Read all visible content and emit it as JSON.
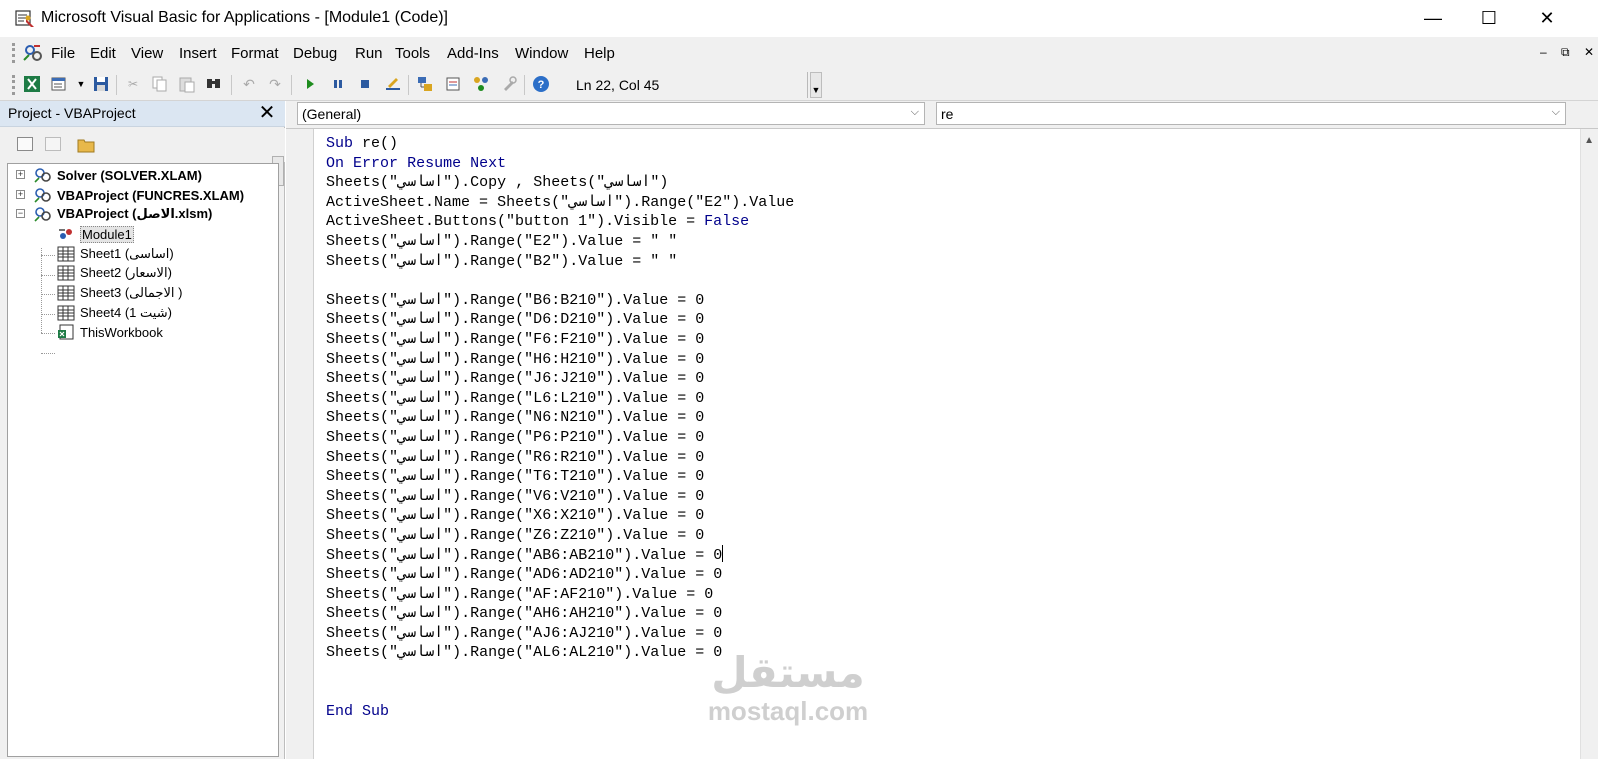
{
  "window": {
    "title": "Microsoft Visual Basic for Applications - [Module1 (Code)]",
    "minimize": "—",
    "maximize": "☐",
    "close": "✕"
  },
  "menu": {
    "items": [
      "File",
      "Edit",
      "View",
      "Insert",
      "Format",
      "Debug",
      "Run",
      "Tools",
      "Add-Ins",
      "Window",
      "Help"
    ],
    "mdi": {
      "minimize": "–",
      "restore": "⧉",
      "close": "✕"
    }
  },
  "toolbar": {
    "status": "Ln 22, Col 45",
    "icons": [
      "excel-icon",
      "insert-module-icon",
      "save-icon",
      "cut-icon",
      "copy-icon",
      "paste-icon",
      "find-icon",
      "undo-icon",
      "redo-icon",
      "run-icon",
      "break-icon",
      "reset-icon",
      "design-mode-icon",
      "project-explorer-icon",
      "properties-icon",
      "object-browser-icon",
      "toolbox-icon",
      "help-icon"
    ]
  },
  "project": {
    "title": "Project - VBAProject",
    "close": "✕",
    "nodes": [
      {
        "label": "Solver (SOLVER.XLAM)",
        "expander": "+"
      },
      {
        "label": "VBAProject (FUNCRES.XLAM)",
        "expander": "+"
      },
      {
        "label": "VBAProject (الاصل.xlsm)",
        "expander": "−"
      },
      {
        "label": "Module1"
      },
      {
        "label": "Sheet1 (اساسى)"
      },
      {
        "label": "Sheet2 (الاسعار)"
      },
      {
        "label": "Sheet3 (الاجمالى )"
      },
      {
        "label": "Sheet4 (شيت 1)"
      },
      {
        "label": "ThisWorkbook"
      }
    ]
  },
  "code": {
    "object_combo": "(General)",
    "proc_combo": "re",
    "lines": [
      "Sub re()",
      "On Error Resume Next",
      "Sheets(\"اساسي\").Copy , Sheets(\"اساسي\")",
      "ActiveSheet.Name = Sheets(\"اساسي\").Range(\"E2\").Value",
      "ActiveSheet.Buttons(\"button 1\").Visible = False",
      "Sheets(\"اساسي\").Range(\"E2\").Value = \" \"",
      "Sheets(\"اساسي\").Range(\"B2\").Value = \" \"",
      "",
      "Sheets(\"اساسي\").Range(\"B6:B210\").Value = 0",
      "Sheets(\"اساسي\").Range(\"D6:D210\").Value = 0",
      "Sheets(\"اساسي\").Range(\"F6:F210\").Value = 0",
      "Sheets(\"اساسي\").Range(\"H6:H210\").Value = 0",
      "Sheets(\"اساسي\").Range(\"J6:J210\").Value = 0",
      "Sheets(\"اساسي\").Range(\"L6:L210\").Value = 0",
      "Sheets(\"اساسي\").Range(\"N6:N210\").Value = 0",
      "Sheets(\"اساسي\").Range(\"P6:P210\").Value = 0",
      "Sheets(\"اساسي\").Range(\"R6:R210\").Value = 0",
      "Sheets(\"اساسي\").Range(\"T6:T210\").Value = 0",
      "Sheets(\"اساسي\").Range(\"V6:V210\").Value = 0",
      "Sheets(\"اساسي\").Range(\"X6:X210\").Value = 0",
      "Sheets(\"اساسي\").Range(\"Z6:Z210\").Value = 0",
      "Sheets(\"اساسي\").Range(\"AB6:AB210\").Value = 0",
      "Sheets(\"اساسي\").Range(\"AD6:AD210\").Value = 0",
      "Sheets(\"اساسي\").Range(\"AF:AF210\").Value = 0",
      "Sheets(\"اساسي\").Range(\"AH6:AH210\").Value = 0",
      "Sheets(\"اساسي\").Range(\"AJ6:AJ210\").Value = 0",
      "Sheets(\"اساسي\").Range(\"AL6:AL210\").Value = 0",
      "",
      "",
      "End Sub"
    ],
    "keywords": [
      "Sub",
      "On",
      "Error",
      "Resume",
      "Next",
      "False",
      "End"
    ],
    "keyword_color": "#00008b",
    "cursor_line": 22,
    "cursor_col": 45
  },
  "watermark": {
    "arabic": "مستقل",
    "latin": "mostaql.com"
  }
}
